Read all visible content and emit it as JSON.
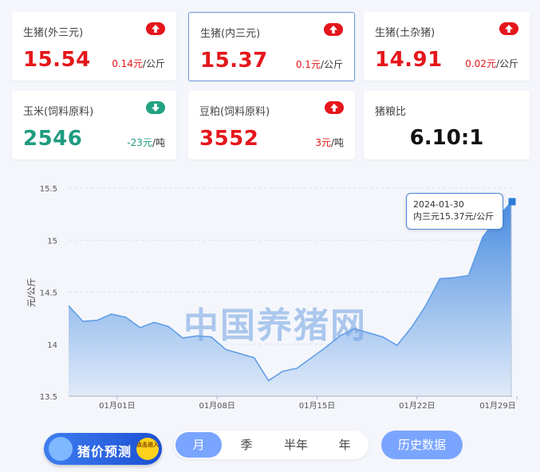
{
  "cards": [
    {
      "name": "生猪(外三元)",
      "price": "15.54",
      "change": "0.14元",
      "unit": "/公斤",
      "trend": "up"
    },
    {
      "name": "生猪(内三元)",
      "price": "15.37",
      "change": "0.1元",
      "unit": "/公斤",
      "trend": "up"
    },
    {
      "name": "生猪(土杂猪)",
      "price": "14.91",
      "change": "0.02元",
      "unit": "/公斤",
      "trend": "up"
    },
    {
      "name": "玉米(饲料原料)",
      "price": "2546",
      "change": "-23元",
      "unit": "/吨",
      "trend": "down"
    },
    {
      "name": "豆粕(饲料原料)",
      "price": "3552",
      "change": "3元",
      "unit": "/吨",
      "trend": "up"
    },
    {
      "name": "猪粮比",
      "value": "6.10:1"
    }
  ],
  "colors": {
    "up": "#e5161b",
    "down": "#1f9c7f",
    "accent": "#7aa5ff",
    "line": "#5b9be6"
  },
  "chart_data": {
    "type": "area",
    "ylabel": "元/公斤",
    "ylim": [
      13.5,
      15.5
    ],
    "yticks": [
      "13.5",
      "14",
      "14.5",
      "15",
      "15.5"
    ],
    "xtick_labels": [
      "01月01日",
      "01月08日",
      "01月15日",
      "01月22日",
      "01月29日"
    ],
    "grid": true,
    "values": [
      14.37,
      14.22,
      14.23,
      14.29,
      14.26,
      14.16,
      14.21,
      14.17,
      14.06,
      14.08,
      14.07,
      13.95,
      13.91,
      13.87,
      13.65,
      13.74,
      13.77,
      13.87,
      13.97,
      14.08,
      14.15,
      14.11,
      14.07,
      13.99,
      14.16,
      14.37,
      14.63,
      14.64,
      14.66,
      15.03,
      15.21,
      15.37
    ],
    "series_name": "内三元",
    "tooltip": {
      "date": "2024-01-30",
      "text": "内三元15.37元/公斤"
    }
  },
  "watermark": "中国养猪网",
  "predict": {
    "label": "猪价预测",
    "badge": "点击进入"
  },
  "periods": [
    "月",
    "季",
    "半年",
    "年"
  ],
  "active_period": "月",
  "history_button": "历史数据"
}
